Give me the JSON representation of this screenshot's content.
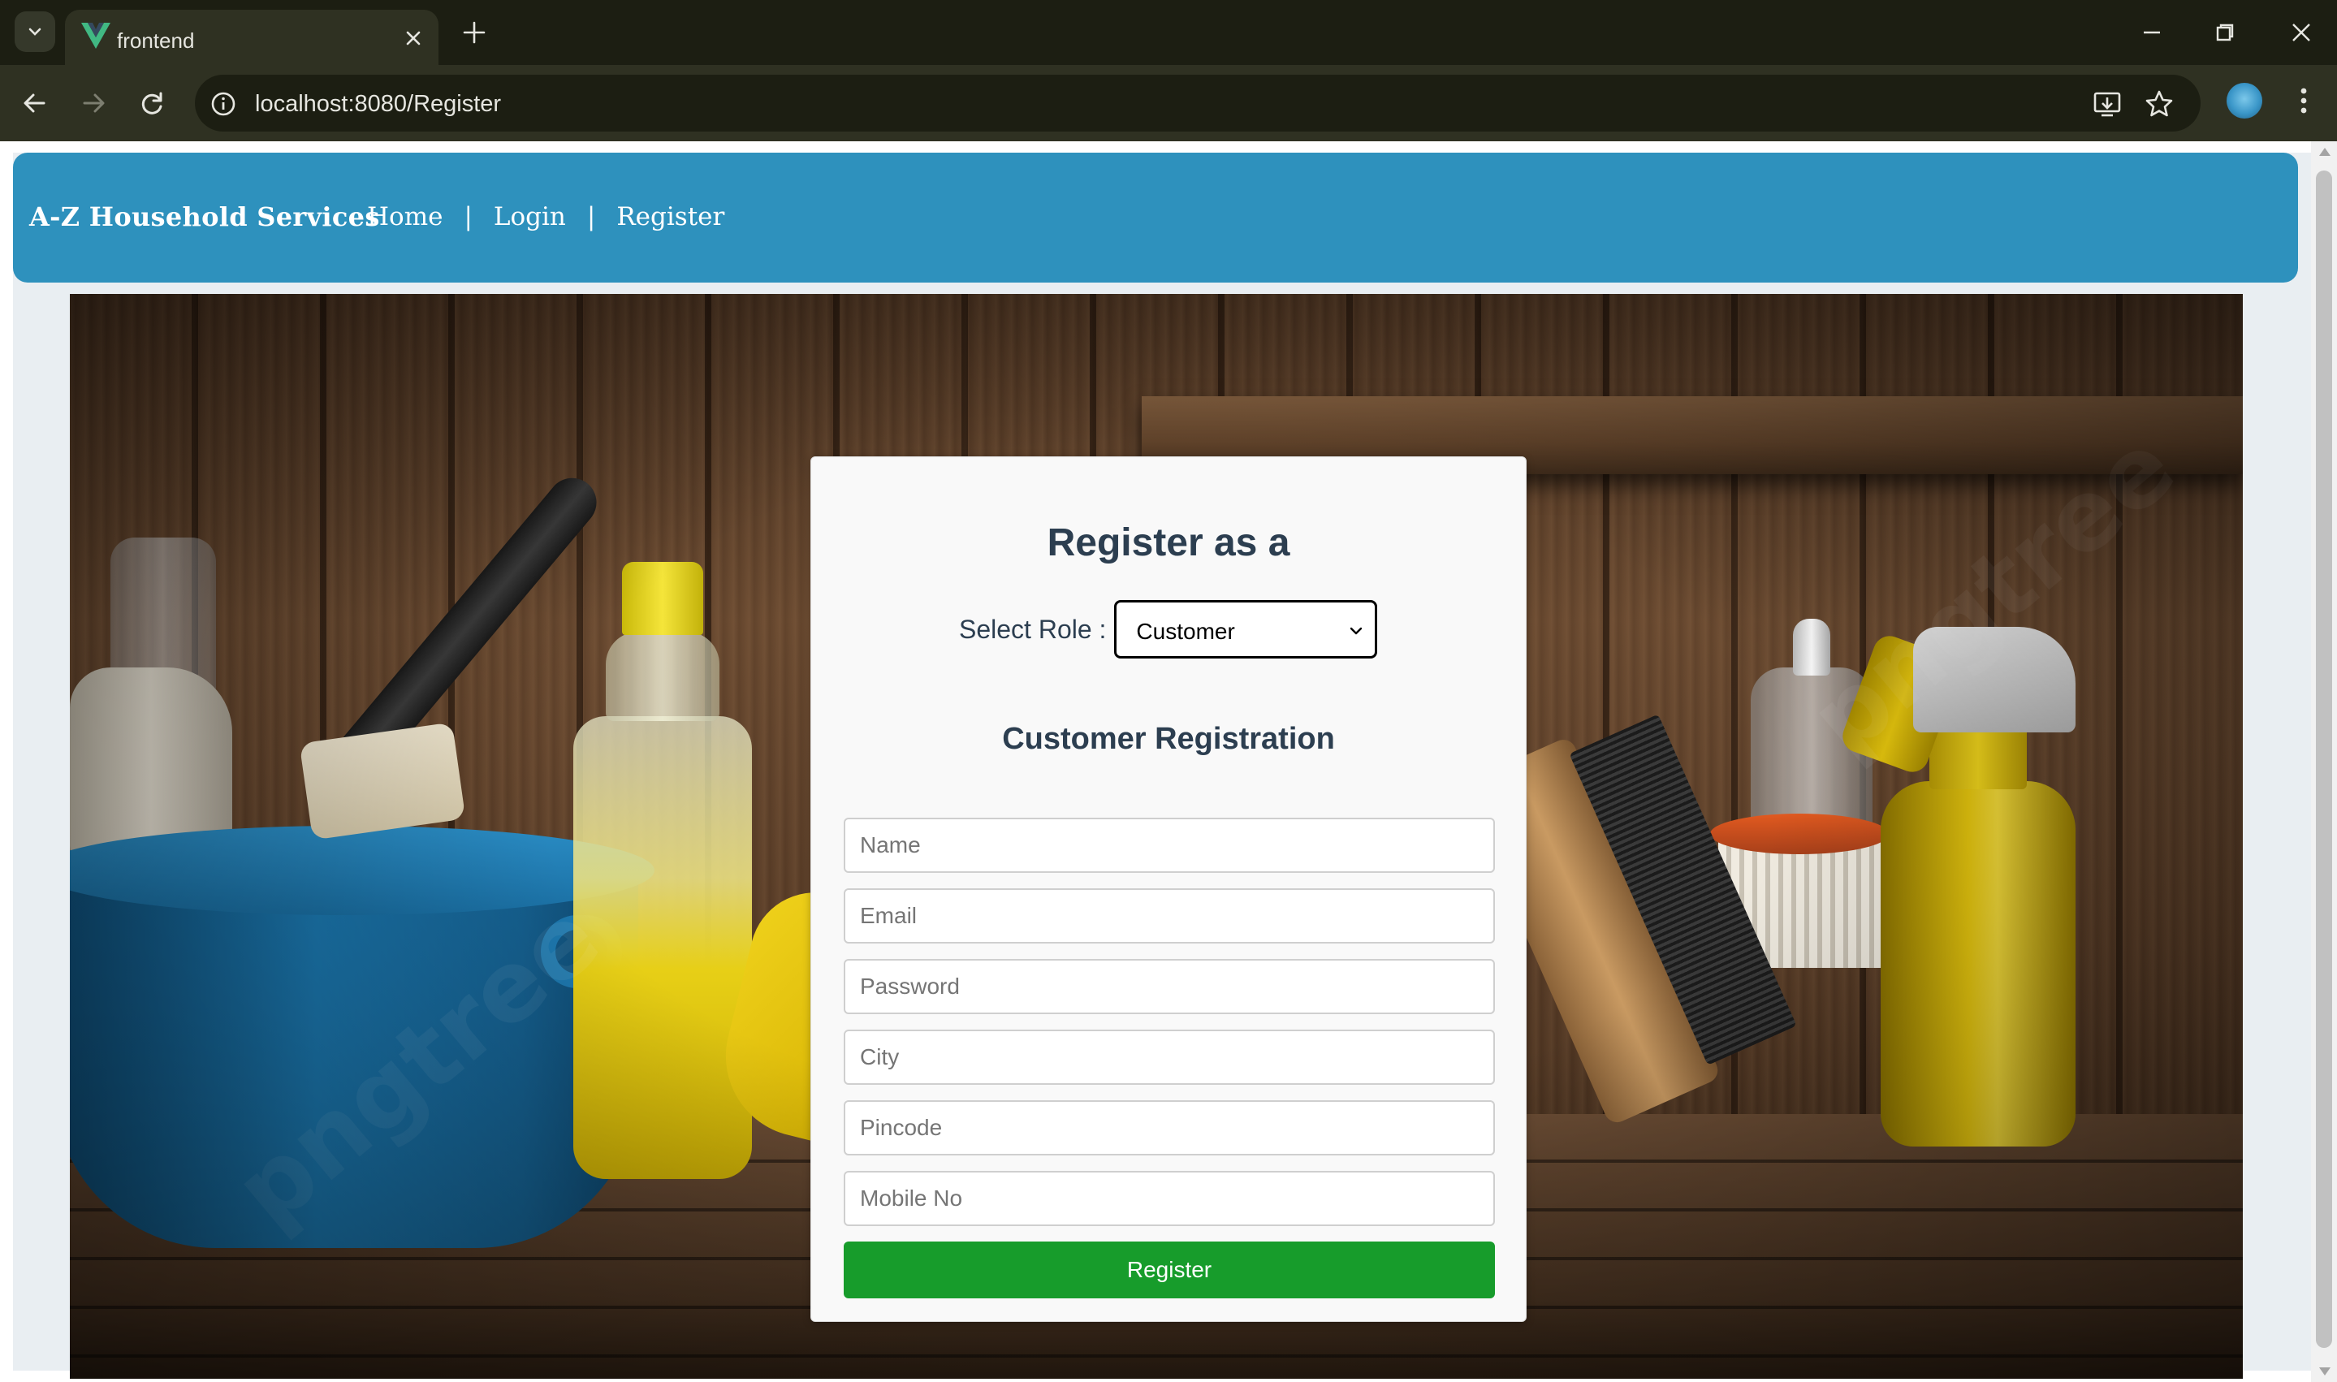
{
  "browser": {
    "tab_title": "frontend",
    "url": "localhost:8080/Register",
    "favicon": "vue-logo-icon",
    "accent_color": "#2f3122"
  },
  "navbar": {
    "brand": "A-Z Household Services",
    "links": [
      "Home",
      "Login",
      "Register"
    ],
    "separator": "|",
    "background_color": "#2e91bd"
  },
  "register_card": {
    "title": "Register as a",
    "role_label": "Select Role :",
    "role_selected": "Customer",
    "subtitle": "Customer Registration",
    "fields": {
      "name": "Name",
      "email": "Email",
      "password": "Password",
      "city": "City",
      "pincode": "Pincode",
      "mobile": "Mobile No"
    },
    "submit_label": "Register",
    "submit_color": "#179c2b"
  }
}
